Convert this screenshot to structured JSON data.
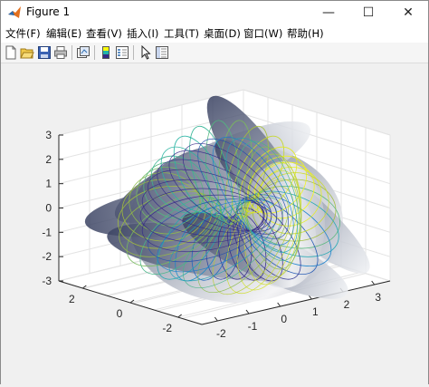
{
  "window": {
    "title": "Figure 1",
    "controls": {
      "minimize": "—",
      "maximize": "☐",
      "close": "✕"
    }
  },
  "menu": [
    {
      "label": "文件(F)"
    },
    {
      "label": "编辑(E)"
    },
    {
      "label": "查看(V)"
    },
    {
      "label": "插入(I)"
    },
    {
      "label": "工具(T)"
    },
    {
      "label": "桌面(D)"
    },
    {
      "label": "窗口(W)"
    },
    {
      "label": "帮助(H)"
    }
  ],
  "toolbar": [
    {
      "icon": "new-figure-icon"
    },
    {
      "icon": "open-file-icon"
    },
    {
      "icon": "save-icon"
    },
    {
      "icon": "print-icon"
    },
    {
      "icon": "link-plot-icon"
    },
    {
      "icon": "insert-colorbar-icon"
    },
    {
      "icon": "insert-legend-icon"
    },
    {
      "icon": "pointer-icon"
    },
    {
      "icon": "property-inspector-icon"
    }
  ],
  "plot": {
    "type": "3d-surface",
    "colormap": "parula",
    "grid": true,
    "z_ticks": [
      "3",
      "2",
      "1",
      "0",
      "-1",
      "-2",
      "-3"
    ],
    "x_ticks": [
      "-2",
      "-1",
      "0",
      "1",
      "2",
      "3"
    ],
    "y_ticks": [
      "2",
      "0",
      "-2"
    ]
  },
  "colors": {
    "accent": "#0072bd",
    "colormap_low": "#352a87",
    "colormap_mid": "#21b3a9",
    "colormap_high": "#f9fb0e"
  }
}
